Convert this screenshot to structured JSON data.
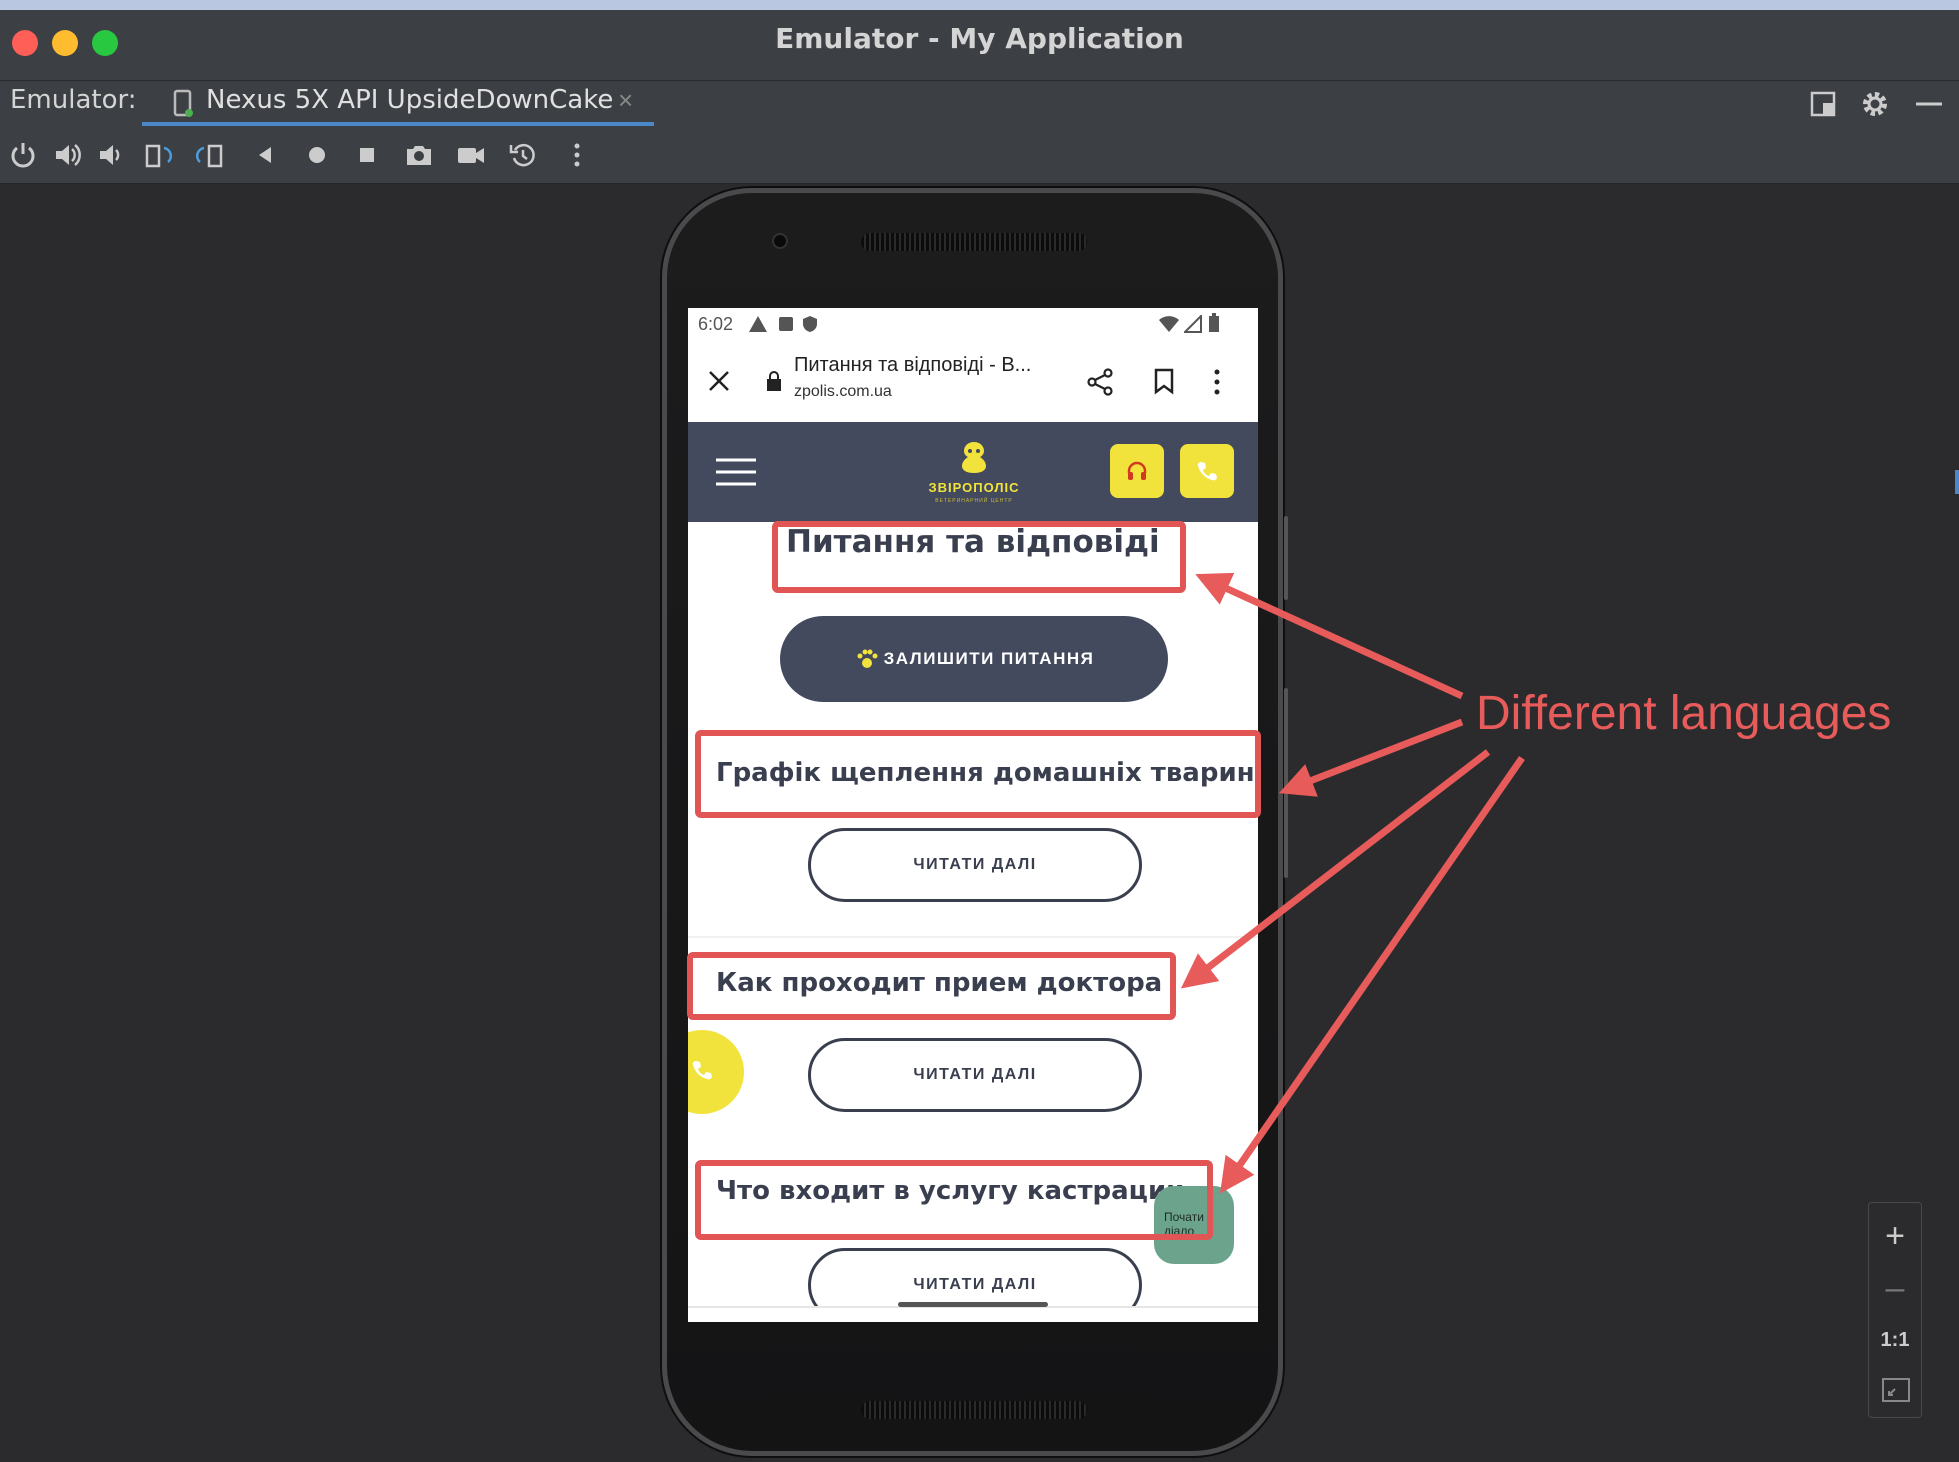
{
  "window": {
    "title": "Emulator - My Application"
  },
  "tabbar": {
    "label": "Emulator:",
    "device_tab": "Nexus 5X API UpsideDownCake",
    "close_glyph": "×"
  },
  "status": {
    "time": "6:02"
  },
  "browser": {
    "page_title": "Питання та відповіді - В...",
    "host": "zpolis.com.ua"
  },
  "site": {
    "logo_text": "ЗВІРОПОЛІС",
    "logo_sub": "ВЕТЕРИНАРНИЙ ЦЕНТР"
  },
  "content": {
    "heading": "Питання та відповіді",
    "leave_question_button": "ЗАЛИШИТИ ПИТАННЯ",
    "articles": [
      {
        "title": "Графік щеплення домашніх тварин",
        "button": "ЧИТАТИ ДАЛІ"
      },
      {
        "title": "Как проходит прием доктора",
        "button": "ЧИТАТИ ДАЛІ"
      },
      {
        "title": "Что входит в услугу кастрации",
        "button": "ЧИТАТИ ДАЛІ"
      }
    ],
    "chat_bubble": "Почати діало"
  },
  "annotation": {
    "text": "Different languages",
    "color": "#e85b5b"
  },
  "zoom": {
    "plus": "+",
    "minus": "–",
    "one_to_one": "1:1"
  },
  "colors": {
    "site_header": "#434a5d",
    "accent_yellow": "#f2e33c",
    "chat_green": "#6ba38c"
  }
}
